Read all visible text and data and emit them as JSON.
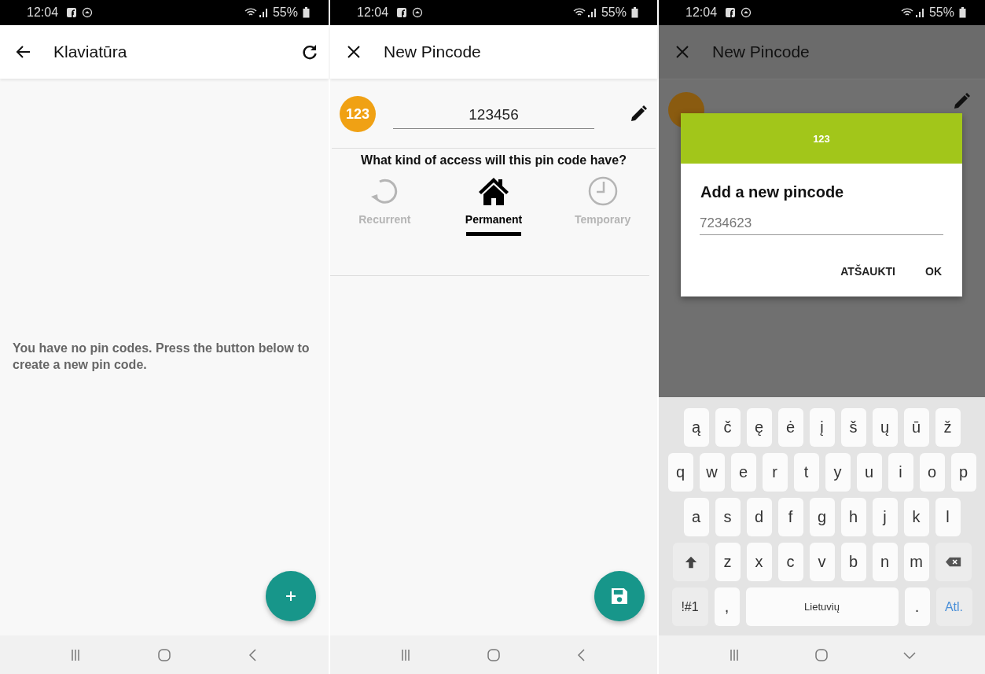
{
  "screens": [
    {
      "kind": "list",
      "status_bar": {
        "time": "12:04",
        "battery": "55%"
      },
      "app_bar": {
        "title": "Klaviatūra"
      },
      "empty_message": "You have no pin codes. Press the button below to create a new pin code.",
      "fab": {
        "kind": "add"
      },
      "nav_bar": {
        "kind": "back"
      }
    },
    {
      "kind": "form",
      "status_bar": {
        "time": "12:04",
        "battery": "55%"
      },
      "app_bar": {
        "title": "New Pincode"
      },
      "pin": {
        "badge": "123",
        "value": "123456"
      },
      "question": "What kind of access will this pin code have?",
      "access_types": [
        {
          "label": "Recurrent",
          "selected": false
        },
        {
          "label": "Permanent",
          "selected": true
        },
        {
          "label": "Temporary",
          "selected": false
        }
      ],
      "fab": {
        "kind": "save"
      },
      "nav_bar": {
        "kind": "back"
      }
    },
    {
      "kind": "dialog",
      "status_bar": {
        "time": "12:04",
        "battery": "55%"
      },
      "app_bar": {
        "title": "New Pincode"
      },
      "dialog": {
        "header": "123",
        "title": "Add a new pincode",
        "value": "7234623",
        "buttons": [
          "ATŠAUKTI",
          "OK"
        ]
      },
      "keyboard": {
        "rows": [
          {
            "keys": [
              {
                "kind": "letter",
                "label": "ą"
              },
              {
                "kind": "letter",
                "label": "č"
              },
              {
                "kind": "letter",
                "label": "ę"
              },
              {
                "kind": "letter",
                "label": "ė"
              },
              {
                "kind": "letter",
                "label": "į"
              },
              {
                "kind": "letter",
                "label": "š"
              },
              {
                "kind": "letter",
                "label": "ų"
              },
              {
                "kind": "letter",
                "label": "ū"
              },
              {
                "kind": "letter",
                "label": "ž"
              }
            ]
          },
          {
            "keys": [
              {
                "kind": "letter",
                "label": "q"
              },
              {
                "kind": "letter",
                "label": "w"
              },
              {
                "kind": "letter",
                "label": "e"
              },
              {
                "kind": "letter",
                "label": "r"
              },
              {
                "kind": "letter",
                "label": "t"
              },
              {
                "kind": "letter",
                "label": "y"
              },
              {
                "kind": "letter",
                "label": "u"
              },
              {
                "kind": "letter",
                "label": "i"
              },
              {
                "kind": "letter",
                "label": "o"
              },
              {
                "kind": "letter",
                "label": "p"
              }
            ]
          },
          {
            "keys": [
              {
                "kind": "letter",
                "label": "a"
              },
              {
                "kind": "letter",
                "label": "s"
              },
              {
                "kind": "letter",
                "label": "d"
              },
              {
                "kind": "letter",
                "label": "f"
              },
              {
                "kind": "letter",
                "label": "g"
              },
              {
                "kind": "letter",
                "label": "h"
              },
              {
                "kind": "letter",
                "label": "j"
              },
              {
                "kind": "letter",
                "label": "k"
              },
              {
                "kind": "letter",
                "label": "l"
              }
            ]
          },
          {
            "keys": [
              {
                "kind": "shift"
              },
              {
                "kind": "letter",
                "label": "z"
              },
              {
                "kind": "letter",
                "label": "x"
              },
              {
                "kind": "letter",
                "label": "c"
              },
              {
                "kind": "letter",
                "label": "v"
              },
              {
                "kind": "letter",
                "label": "b"
              },
              {
                "kind": "letter",
                "label": "n"
              },
              {
                "kind": "letter",
                "label": "m"
              },
              {
                "kind": "backspace"
              }
            ]
          },
          {
            "keys": [
              {
                "kind": "symbols",
                "label": "!#1"
              },
              {
                "kind": "letter",
                "label": ","
              },
              {
                "kind": "space",
                "label": "Lietuvių"
              },
              {
                "kind": "letter",
                "label": "."
              },
              {
                "kind": "enter",
                "label": "Atl."
              }
            ]
          }
        ]
      },
      "nav_bar": {
        "kind": "hide"
      }
    }
  ]
}
